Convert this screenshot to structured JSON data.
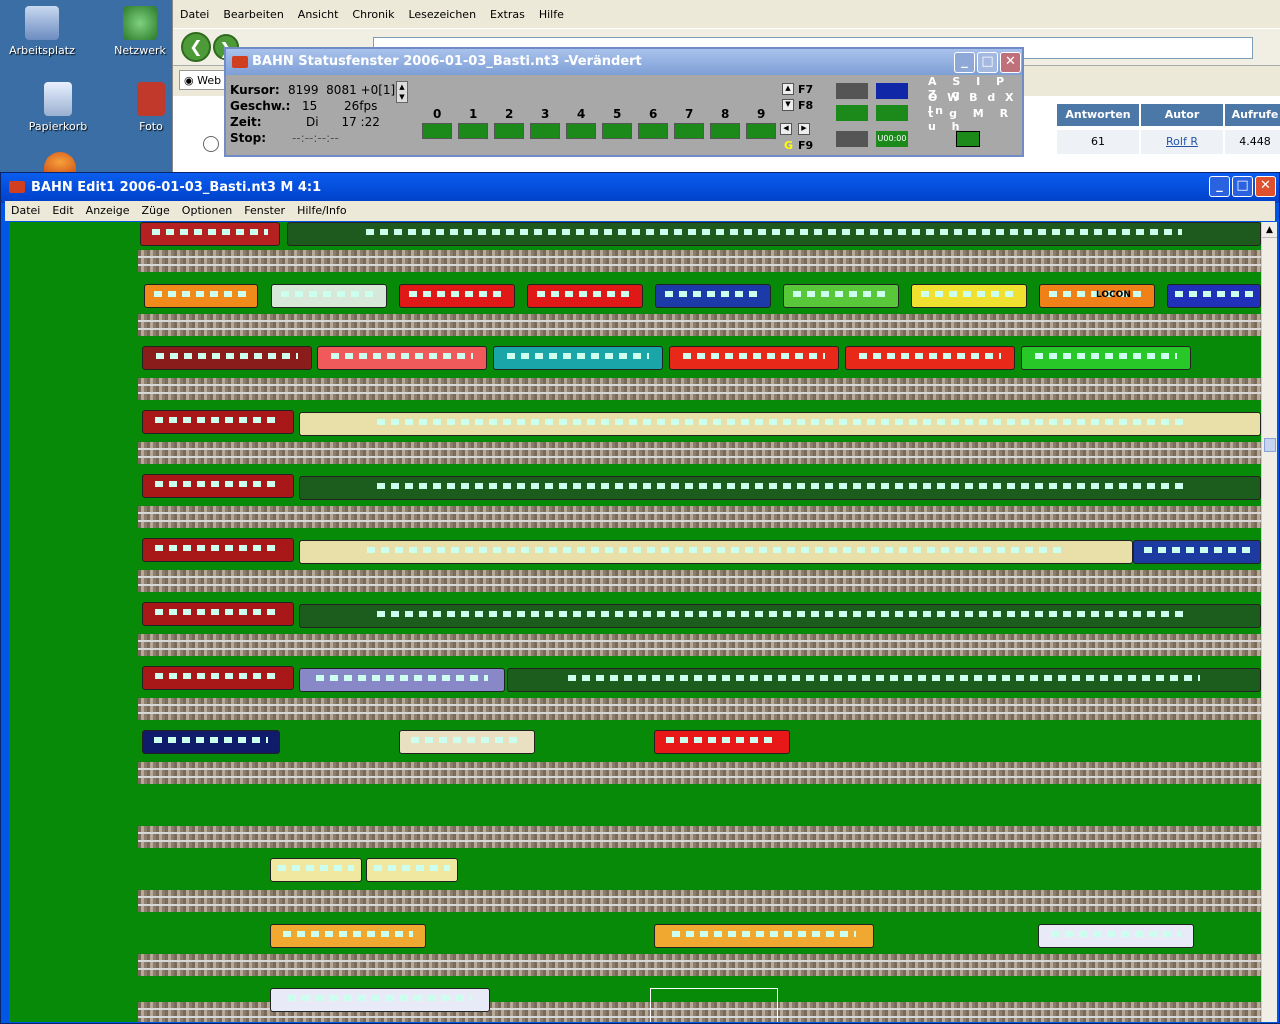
{
  "desktop": {
    "icons": [
      {
        "label": "Arbeitsplatz"
      },
      {
        "label": "Netzwerk"
      },
      {
        "label": "Papierkorb"
      },
      {
        "label": "Foto"
      }
    ]
  },
  "browser": {
    "menu": [
      "Datei",
      "Bearbeiten",
      "Ansicht",
      "Chronik",
      "Lesezeichen",
      "Extras",
      "Hilfe"
    ],
    "tab_label": "Web",
    "table": {
      "headers": [
        "Antworten",
        "Autor",
        "Aufrufe"
      ],
      "row": {
        "antworten": "61",
        "autor": "Rolf R",
        "aufrufe": "4.448"
      }
    }
  },
  "status_window": {
    "title": "BAHN Statusfenster 2006-01-03_Basti.nt3 -Verändert",
    "kursor_label": "Kursor:",
    "kursor_value": "8199  8081 +0[1]",
    "geschw_label": "Geschw.:",
    "geschw_value": "15       26fps",
    "zeit_label": "Zeit:",
    "zeit_value": "Di      17 :22",
    "stop_label": "Stop:",
    "stop_value": "--:--:--:--",
    "track_numbers": [
      "0",
      "1",
      "2",
      "3",
      "4",
      "5",
      "6",
      "7",
      "8",
      "9"
    ],
    "fkeys": [
      "F7",
      "F8",
      "F9"
    ],
    "g_key": "G",
    "clock_value": "U00:00",
    "letters_row1": "A S I P Z q",
    "letters_row2": "O W B d X In",
    "letters_row3": "t g M R u h"
  },
  "editor_window": {
    "title": "BAHN Edit1 2006-01-03_Basti.nt3 M 4:1",
    "menu": [
      "Datei",
      "Edit",
      "Anzeige",
      "Züge",
      "Optionen",
      "Fenster",
      "Hilfe/Info"
    ],
    "loco_label": "LOCON",
    "colors": {
      "ground": "#078a07",
      "title_bar": "#0a5ef0"
    }
  }
}
